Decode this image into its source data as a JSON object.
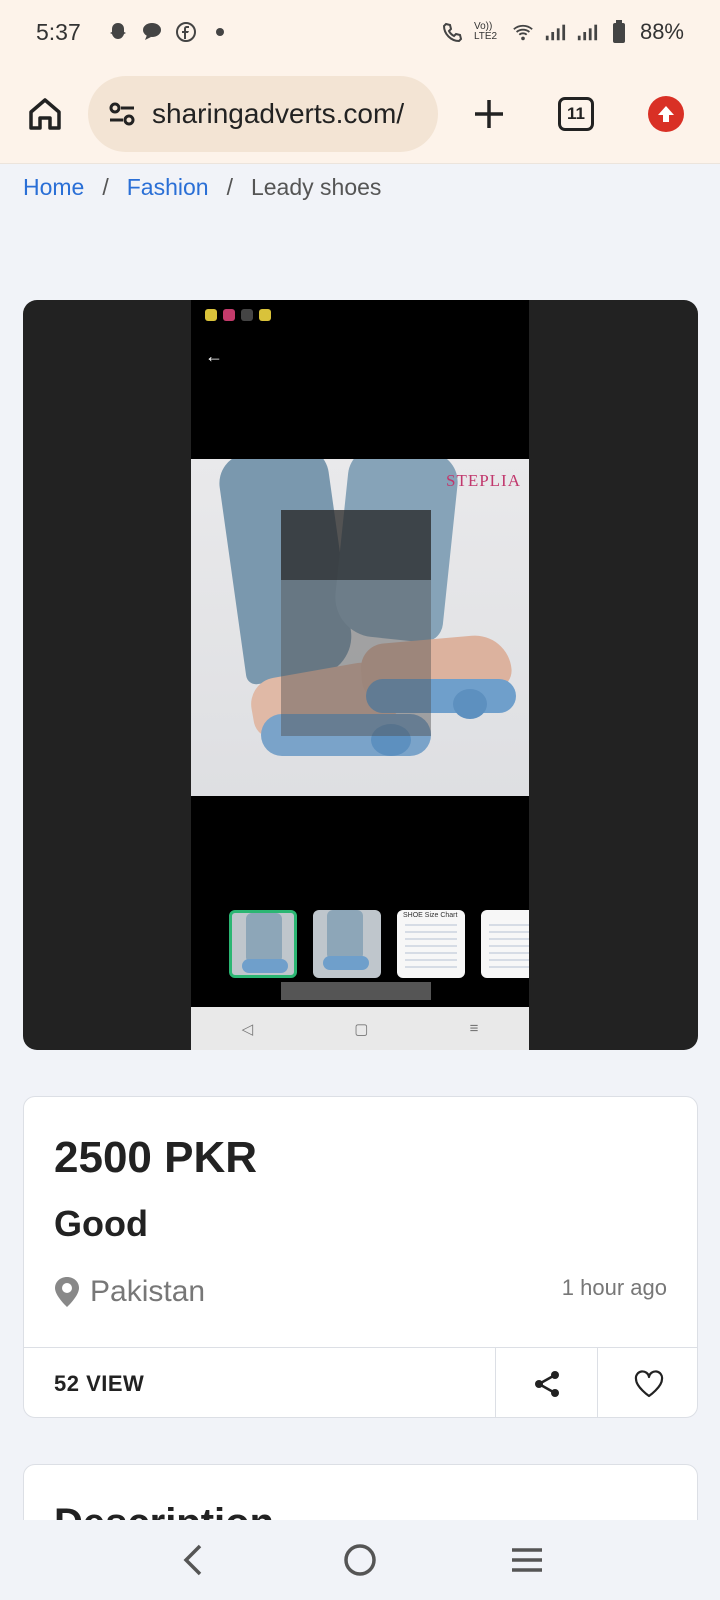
{
  "status_bar": {
    "time": "5:37",
    "network_label": "Vo)) LTE2",
    "battery": "88%"
  },
  "browser": {
    "url": "sharingadverts.com/",
    "tab_count": "11"
  },
  "breadcrumb": {
    "items": [
      "Home",
      "Fashion"
    ],
    "separator": "/",
    "current": "Leady shoes"
  },
  "gallery": {
    "brand_text": "STEPLIA",
    "chart_thumb_label": "SHOE Size Chart",
    "accent_color": "#2bb673"
  },
  "listing": {
    "price": "2500 PKR",
    "condition": "Good",
    "location": "Pakistan",
    "posted": "1 hour ago",
    "views": "52 VIEW"
  },
  "description": {
    "title": "Description"
  }
}
